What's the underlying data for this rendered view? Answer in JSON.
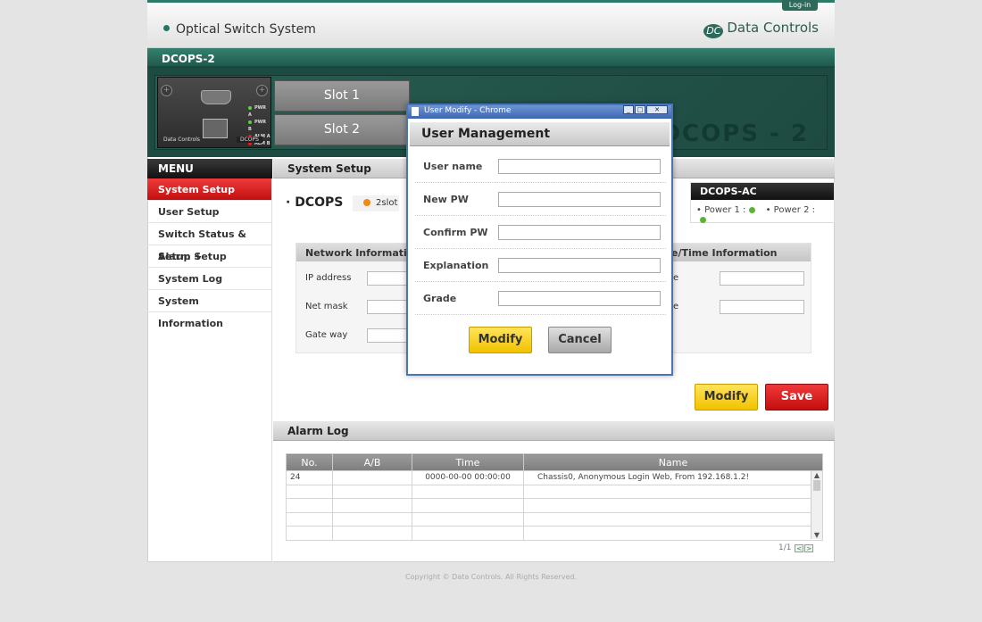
{
  "header": {
    "login": "Log-in",
    "app_title": "Optical Switch System",
    "brand": "Data Controls",
    "brand_logo": "DC"
  },
  "device": {
    "bar_label": "DCOPS-2",
    "slots": [
      "Slot 1",
      "Slot 2"
    ],
    "panel_label": "DCOPS - 2",
    "chassis_brand": "Data Controls",
    "chassis_tag": "DCOPS",
    "leds": [
      "PWR A",
      "PWR B",
      "ALM A",
      "ALM B"
    ]
  },
  "menu": {
    "title": "MENU",
    "items": [
      "System Setup",
      "User Setup",
      "Switch Status & Setup +",
      "Alarm Setup",
      "System Log",
      "System Information"
    ]
  },
  "system_setup": {
    "title": "System Setup",
    "device_name": "· DCOPS",
    "slot_info": "2slot",
    "ac": {
      "title": "DCOPS-AC",
      "power1": "• Power 1 :",
      "power2": "• Power 2 :"
    },
    "network": {
      "title": "Network Information",
      "fields": [
        "IP address",
        "Net mask",
        "Gate way"
      ]
    },
    "datetime": {
      "title": "e/Time Information",
      "fields": [
        "e",
        "e"
      ]
    },
    "modify": "Modify",
    "save": "Save"
  },
  "alarm_log": {
    "title": "Alarm Log",
    "columns": [
      "No.",
      "A/B",
      "Time",
      "Name"
    ],
    "rows": [
      {
        "no": "24",
        "ab": "",
        "time": "0000-00-00  00:00:00",
        "name": "Chassis0, Anonymous Login Web, From 192.168.1.2!"
      }
    ],
    "pager": "1/1"
  },
  "footer": {
    "copyright": "Copyright © Data Controls. All Rights Reserved."
  },
  "dialog": {
    "window_title": "User Modify - Chrome",
    "heading": "User Management",
    "fields": [
      "User name",
      "New PW",
      "Confirm PW",
      "Explanation",
      "Grade"
    ],
    "modify": "Modify",
    "cancel": "Cancel"
  },
  "colors": {
    "accent": "#1f5a4d",
    "active": "#e02424",
    "button_yellow": "#f5cc14",
    "status_ok": "#58b52e",
    "slot_dot": "#f08a1a"
  }
}
